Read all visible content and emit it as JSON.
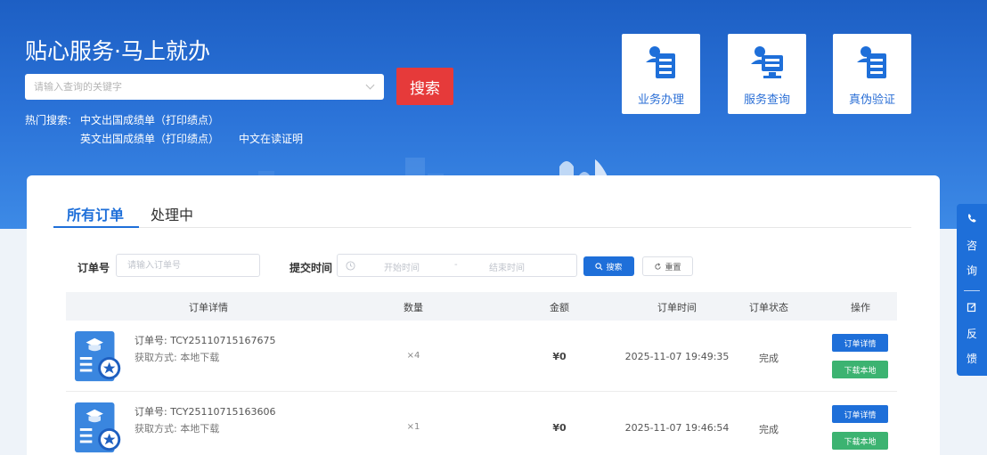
{
  "hero": {
    "title": "贴心服务·马上就办",
    "search_placeholder": "请输入查询的关键字",
    "search_button": "搜索",
    "hot_label": "热门搜索:",
    "hot_items": [
      "中文出国成绩单（打印绩点）",
      "英文出国成绩单（打印绩点）",
      "中文在读证明"
    ]
  },
  "quick_links": [
    {
      "label": "业务办理",
      "icon": "clipboard-person-icon"
    },
    {
      "label": "服务查询",
      "icon": "person-monitor-icon"
    },
    {
      "label": "真伪验证",
      "icon": "clipboard-verify-icon"
    }
  ],
  "tabs": [
    {
      "label": "所有订单",
      "active": true
    },
    {
      "label": "处理中",
      "active": false
    }
  ],
  "filter": {
    "order_label": "订单号",
    "order_placeholder": "请输入订单号",
    "time_label": "提交时间",
    "start_placeholder": "开始时间",
    "dash": "-",
    "end_placeholder": "结束时间",
    "search_button": "搜索",
    "reset_button": "重置"
  },
  "table": {
    "headers": [
      "订单详情",
      "数量",
      "金额",
      "订单时间",
      "订单状态",
      "操作"
    ],
    "rows": [
      {
        "order_no": "订单号: TCY25110715167675",
        "method": "获取方式:  本地下载",
        "qty": "×4",
        "amount": "¥0",
        "time": "2025-11-07 19:49:35",
        "status": "完成",
        "detail_btn": "订单详情",
        "download_btn": "下载本地"
      },
      {
        "order_no": "订单号: TCY25110715163606",
        "method": "获取方式:  本地下载",
        "qty": "×1",
        "amount": "¥0",
        "time": "2025-11-07 19:46:54",
        "status": "完成",
        "detail_btn": "订单详情",
        "download_btn": "下载本地"
      }
    ]
  },
  "side_float": {
    "consult": [
      "咨",
      "询"
    ],
    "feedback": [
      "反",
      "馈"
    ]
  },
  "colors": {
    "primary": "#1e6fd9",
    "danger": "#e63a3a",
    "success": "#3cb371"
  }
}
